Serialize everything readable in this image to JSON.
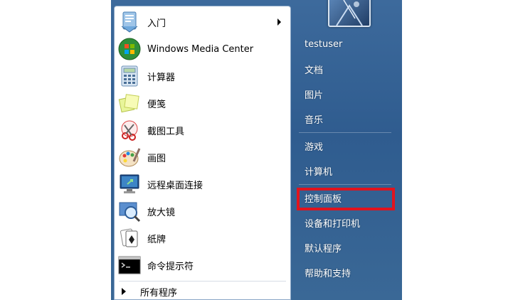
{
  "colors": {
    "highlight": "#e0141e",
    "menu_bg": "#2f5c8f"
  },
  "left_menu": {
    "items": [
      {
        "label": "入门",
        "icon": "getting-started-icon",
        "has_submenu": true
      },
      {
        "label": "Windows Media Center",
        "icon": "windows-media-center-icon"
      },
      {
        "label": "计算器",
        "icon": "calculator-icon"
      },
      {
        "label": "便笺",
        "icon": "sticky-notes-icon"
      },
      {
        "label": "截图工具",
        "icon": "snipping-tool-icon"
      },
      {
        "label": "画图",
        "icon": "paint-icon"
      },
      {
        "label": "远程桌面连接",
        "icon": "remote-desktop-icon"
      },
      {
        "label": "放大镜",
        "icon": "magnifier-icon"
      },
      {
        "label": "纸牌",
        "icon": "solitaire-icon"
      },
      {
        "label": "命令提示符",
        "icon": "command-prompt-icon"
      }
    ],
    "all_programs": "所有程序"
  },
  "right_menu": {
    "user_picture": "user-picture-icon",
    "items": [
      {
        "label": "testuser"
      },
      {
        "label": "文档"
      },
      {
        "label": "图片"
      },
      {
        "label": "音乐"
      },
      {
        "label": "游戏"
      },
      {
        "label": "计算机"
      },
      {
        "label": "控制面板",
        "highlighted": true
      },
      {
        "label": "设备和打印机"
      },
      {
        "label": "默认程序"
      },
      {
        "label": "帮助和支持"
      }
    ]
  }
}
